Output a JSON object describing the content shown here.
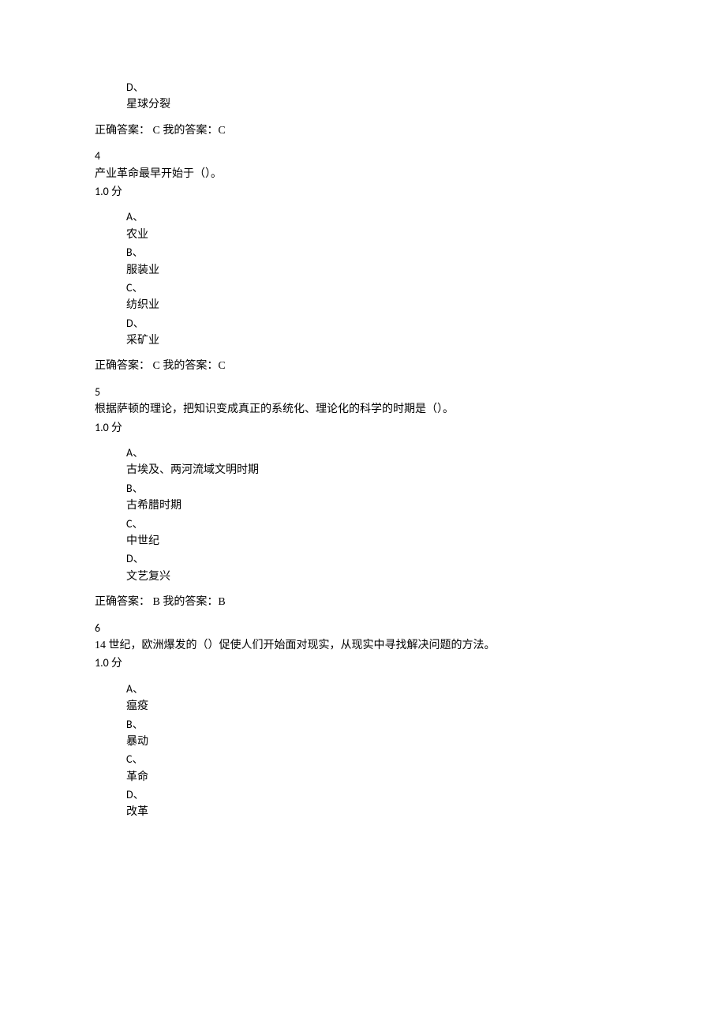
{
  "q3_partial": {
    "option_d_letter": "D、",
    "option_d_text": "星球分裂",
    "answer": "正确答案： C 我的答案：C"
  },
  "q4": {
    "number": "4",
    "stem": "产业革命最早开始于（）。",
    "score": "1.0 分",
    "options": {
      "a_letter": "A、",
      "a_text": "农业",
      "b_letter": "B、",
      "b_text": "服装业",
      "c_letter": "C、",
      "c_text": "纺织业",
      "d_letter": "D、",
      "d_text": "采矿业"
    },
    "answer": "正确答案： C 我的答案：C"
  },
  "q5": {
    "number": "5",
    "stem": "根据萨顿的理论，把知识变成真正的系统化、理论化的科学的时期是（）。",
    "score": "1.0 分",
    "options": {
      "a_letter": "A、",
      "a_text": "古埃及、两河流域文明时期",
      "b_letter": "B、",
      "b_text": "古希腊时期",
      "c_letter": "C、",
      "c_text": "中世纪",
      "d_letter": "D、",
      "d_text": "文艺复兴"
    },
    "answer": "正确答案： B 我的答案：B"
  },
  "q6": {
    "number": "6",
    "stem": "14 世纪，欧洲爆发的（）促使人们开始面对现实，从现实中寻找解决问题的方法。",
    "score": "1.0 分",
    "options": {
      "a_letter": "A、",
      "a_text": "瘟疫",
      "b_letter": "B、",
      "b_text": "暴动",
      "c_letter": "C、",
      "c_text": "革命",
      "d_letter": "D、",
      "d_text": "改革"
    }
  }
}
